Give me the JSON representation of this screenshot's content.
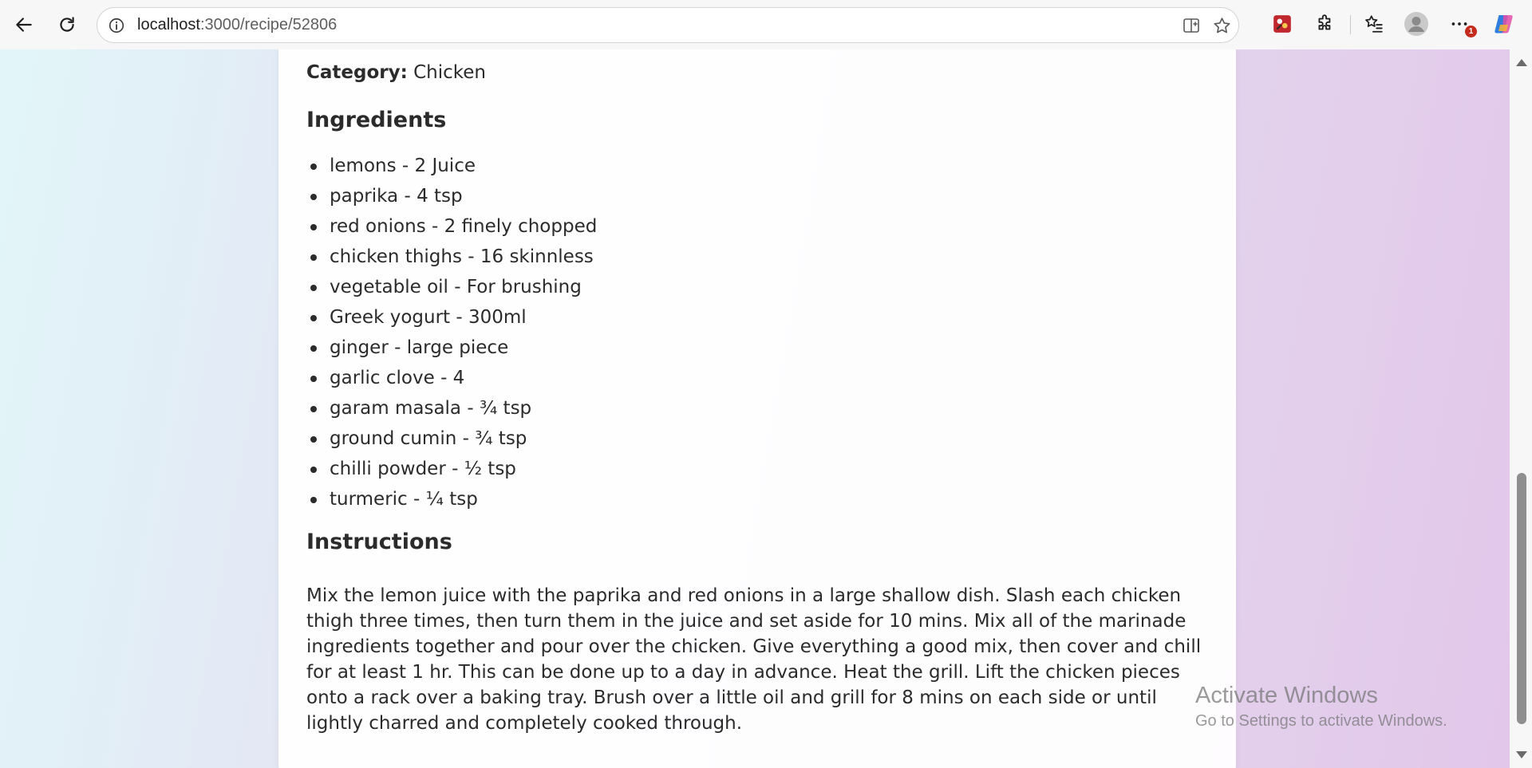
{
  "browser": {
    "url_host": "localhost",
    "url_path": ":3000/recipe/52806",
    "extension_badge": "1",
    "icons": {
      "back": "back-arrow-icon",
      "refresh": "refresh-icon",
      "site_info": "info-icon",
      "split_screen": "split-screen-icon",
      "favorite": "star-icon",
      "extension_red": "paint-extension-icon",
      "extensions": "puzzle-icon",
      "favorites": "favorites-list-icon",
      "profile": "profile-avatar-icon",
      "more": "more-dots-icon",
      "copilot": "copilot-icon"
    }
  },
  "recipe": {
    "category_label": "Category:",
    "category_value": "Chicken",
    "ingredients_heading": "Ingredients",
    "ingredients": [
      "lemons - 2 Juice",
      "paprika - 4 tsp",
      "red onions - 2 finely chopped",
      "chicken thighs - 16 skinnless",
      "vegetable oil - For brushing",
      "Greek yogurt - 300ml",
      "ginger - large piece",
      "garlic clove - 4",
      "garam masala - ¾ tsp",
      "ground cumin - ¾ tsp",
      "chilli powder - ½ tsp",
      "turmeric - ¼ tsp"
    ],
    "instructions_heading": "Instructions",
    "instructions_text": "Mix the lemon juice with the paprika and red onions in a large shallow dish. Slash each chicken thigh three times, then turn them in the juice and set aside for 10 mins. Mix all of the marinade ingredients together and pour over the chicken. Give everything a good mix, then cover and chill for at least 1 hr. This can be done up to a day in advance. Heat the grill. Lift the chicken pieces onto a rack over a baking tray. Brush over a little oil and grill for 8 mins on each side or until lightly charred and completely cooked through."
  },
  "watermark": {
    "title": "Activate Windows",
    "subtitle": "Go to Settings to activate Windows."
  },
  "colors": {
    "gradient_left": "#e2f6f9",
    "gradient_right": "#e2c6ea",
    "text": "#2b2b2b",
    "badge": "#c42b1c"
  }
}
